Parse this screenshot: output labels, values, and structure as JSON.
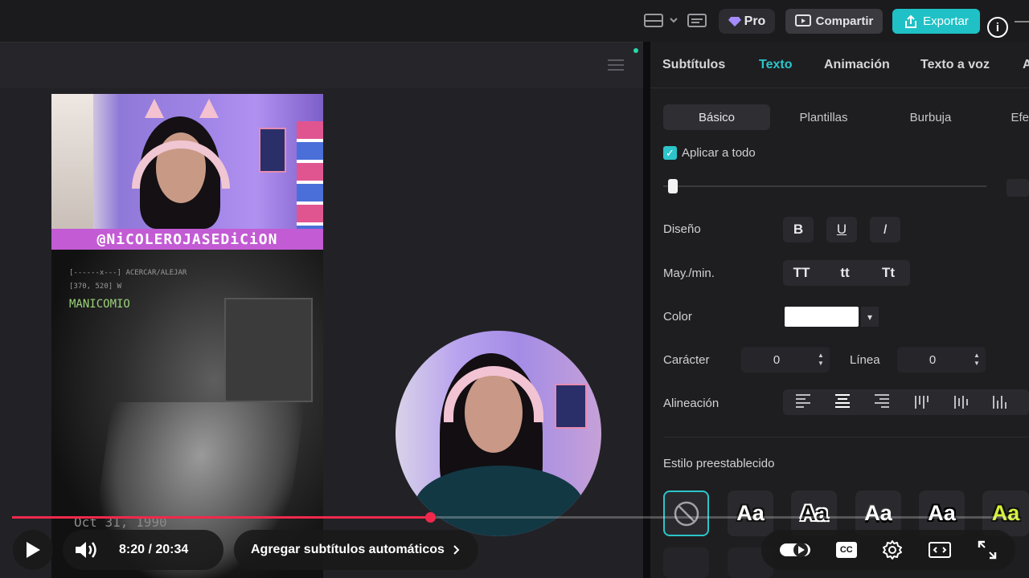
{
  "topbar": {
    "pro_label": "Pro",
    "share_label": "Compartir",
    "export_label": "Exportar"
  },
  "video": {
    "handle": "@NiCOLEROJASEDiCiON",
    "hud_line1": "[------x---] ACERCAR/ALEJAR",
    "hud_line2": "[370, 520] W",
    "hud_location": "MANICOMIO",
    "date_stamp": "Oct 31, 1990"
  },
  "panel": {
    "tabs": [
      {
        "label": "Subtítulos"
      },
      {
        "label": "Texto"
      },
      {
        "label": "Animación"
      },
      {
        "label": "Texto a voz"
      }
    ],
    "active_tab": "Texto",
    "sub_tabs": [
      {
        "label": "Básico"
      },
      {
        "label": "Plantillas"
      },
      {
        "label": "Burbuja"
      },
      {
        "label": "Efe"
      }
    ],
    "apply_all_label": "Aplicar a todo",
    "design_label": "Diseño",
    "design_buttons": [
      "B",
      "U",
      "I"
    ],
    "case_label": "May./min.",
    "case_buttons": [
      "TT",
      "tt",
      "Tt"
    ],
    "color_label": "Color",
    "color_value": "#ffffff",
    "char_label": "Carácter",
    "char_value": "0",
    "line_label": "Línea",
    "line_value": "0",
    "align_label": "Alineación",
    "preset_label": "Estilo preestablecido",
    "preset_text": "Aa",
    "accent_color": "#2cc5c9"
  },
  "player": {
    "time": "8:20 / 20:34",
    "auto_subtitles": "Agregar subtítulos automáticos",
    "progress": 0.416,
    "progress_color": "#f0294c",
    "cc_label": "CC"
  }
}
